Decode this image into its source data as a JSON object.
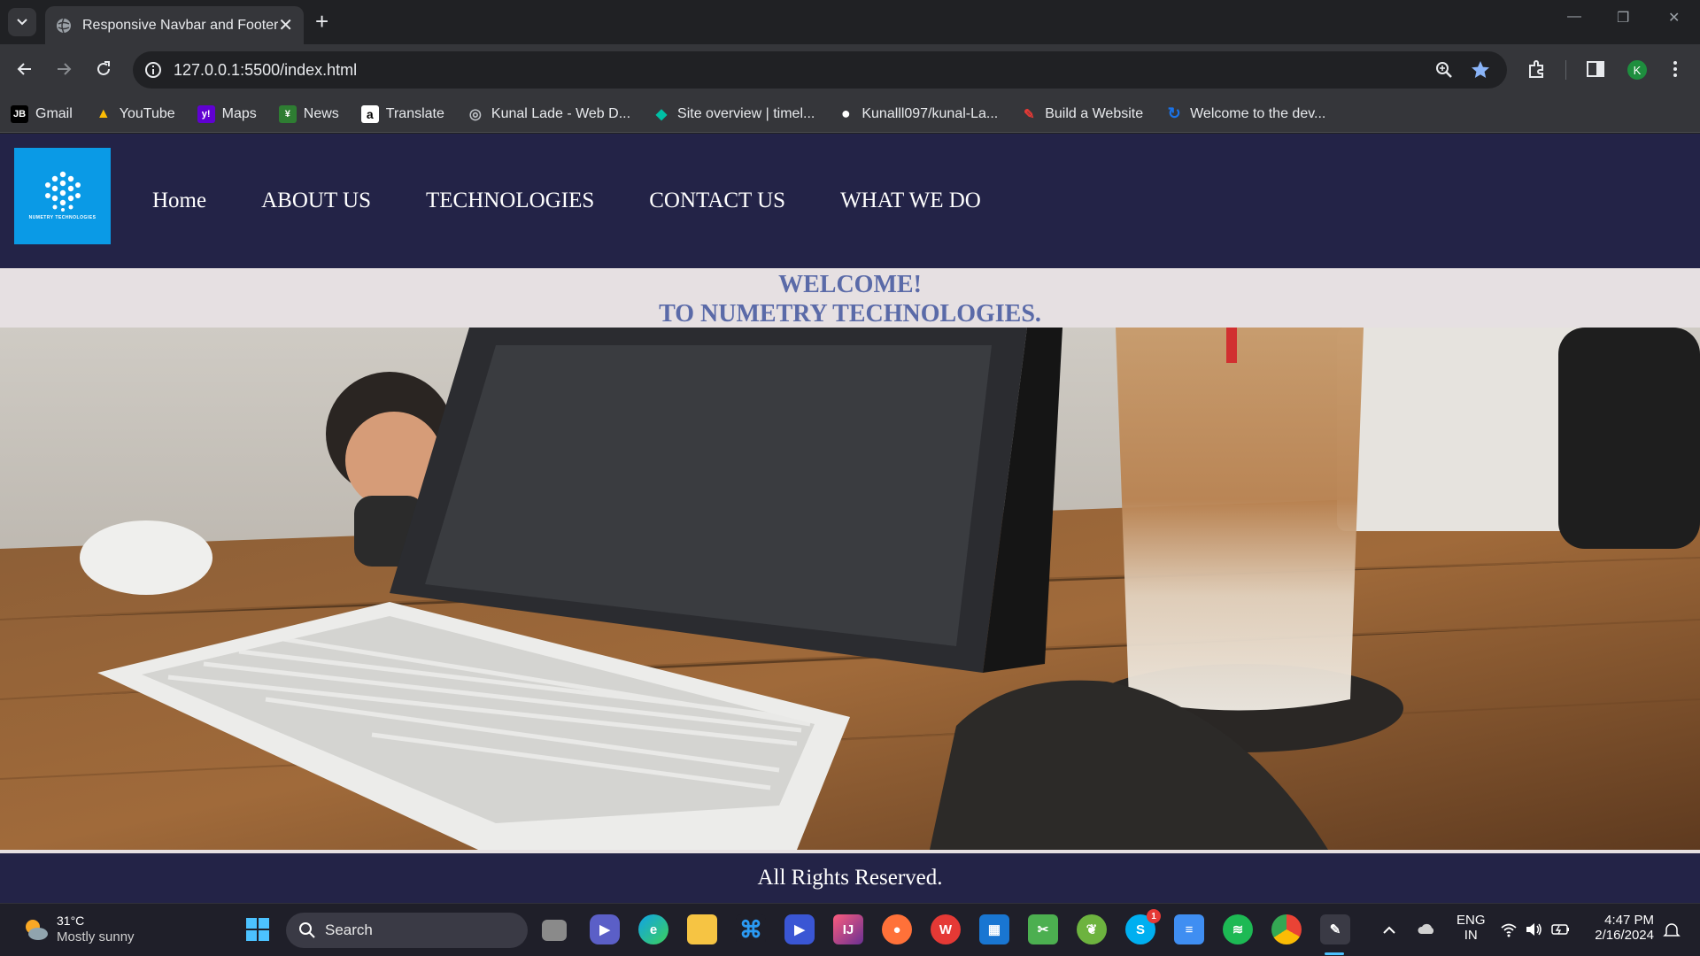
{
  "browser": {
    "tab_title": "Responsive Navbar and Footer",
    "tab_close": "✕",
    "new_tab": "+",
    "url": "127.0.0.1:5500/index.html",
    "profile_initial": "K",
    "bookmarks": [
      {
        "label": "Gmail",
        "icon": "jetbrains-icon",
        "color": "#000000",
        "glyph": "JB"
      },
      {
        "label": "YouTube",
        "icon": "google-drive-icon",
        "color": "#34a853",
        "glyph": "▲"
      },
      {
        "label": "Maps",
        "icon": "yahoo-icon",
        "color": "#6001d2",
        "glyph": "y!"
      },
      {
        "label": "News",
        "icon": "news-icon",
        "color": "#2e7d32",
        "glyph": "¥"
      },
      {
        "label": "Translate",
        "icon": "amazon-icon",
        "color": "#ffffff",
        "glyph": "a"
      },
      {
        "label": "Kunal Lade - Web D...",
        "icon": "globe-icon",
        "color": "#5f6368",
        "glyph": "◎"
      },
      {
        "label": "Site overview | timel...",
        "icon": "diamond-icon",
        "color": "#00bfa5",
        "glyph": "◆"
      },
      {
        "label": "Kunalll097/kunal-La...",
        "icon": "github-icon",
        "color": "#ffffff",
        "glyph": "●"
      },
      {
        "label": "Build a Website",
        "icon": "build-icon",
        "color": "#c62828",
        "glyph": "✎"
      },
      {
        "label": "Welcome to the dev...",
        "icon": "refresh-logo-icon",
        "color": "#1a73e8",
        "glyph": "↻"
      }
    ]
  },
  "site": {
    "logo_text": "NUMETRY TECHNOLOGIES",
    "nav": [
      "Home",
      "ABOUT US",
      "TECHNOLOGIES",
      "CONTACT US",
      "WHAT WE DO"
    ],
    "welcome_line1": "WELCOME!",
    "welcome_line2": "TO NUMETRY TECHNOLOGIES.",
    "footer": "All Rights Reserved."
  },
  "taskbar": {
    "temperature": "31°C",
    "weather": "Mostly sunny",
    "search_placeholder": "Search",
    "language": "ENG",
    "region": "IN",
    "time": "4:47 PM",
    "date": "2/16/2024",
    "skype_badge": "1"
  },
  "colors": {
    "navbar": "#232347",
    "logo_bg": "#0a9ae6",
    "welcome_text": "#5a6aa8",
    "page_bg": "#e6e0e2"
  }
}
